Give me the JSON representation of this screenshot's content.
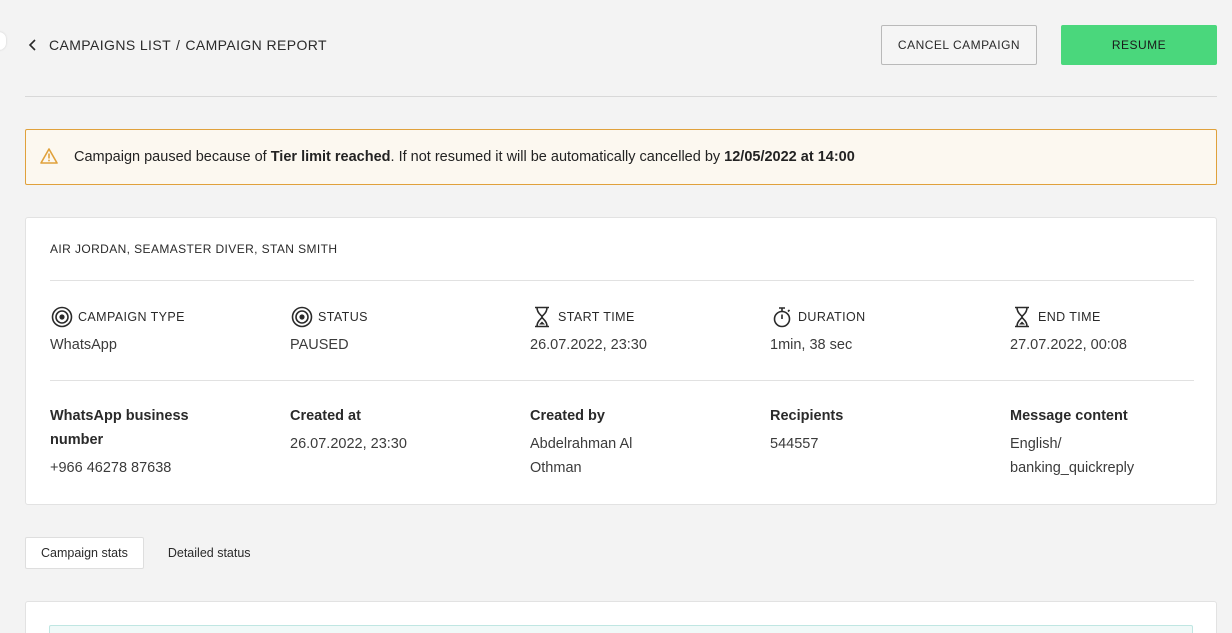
{
  "header": {
    "breadcrumb_list": "CAMPAIGNS LIST",
    "breadcrumb_sep": "/",
    "breadcrumb_current": "CAMPAIGN REPORT",
    "cancel_label": "CANCEL CAMPAIGN",
    "resume_label": "RESUME"
  },
  "alert": {
    "prefix": "Campaign paused because of ",
    "reason": "Tier limit reached",
    "middle": ". If not resumed it will be automatically cancelled by ",
    "deadline": "12/05/2022 at 14:00",
    "icon": "warning-icon"
  },
  "campaign": {
    "title": "AIR JORDAN, SEAMASTER DIVER, STAN SMITH",
    "meta": [
      {
        "icon": "target-icon",
        "label": "CAMPAIGN TYPE",
        "value": "WhatsApp"
      },
      {
        "icon": "target-icon",
        "label": "STATUS",
        "value": "PAUSED"
      },
      {
        "icon": "hourglass-icon",
        "label": "START TIME",
        "value": "26.07.2022, 23:30"
      },
      {
        "icon": "stopwatch-icon",
        "label": "DURATION",
        "value": "1min, 38 sec"
      },
      {
        "icon": "hourglass-icon",
        "label": "END TIME",
        "value": "27.07.2022, 00:08"
      }
    ],
    "info": [
      {
        "label_1": "WhatsApp business",
        "label_2": "number",
        "value_1": "+966 46278 87638",
        "value_2": ""
      },
      {
        "label_1": "Created at",
        "label_2": "",
        "value_1": "26.07.2022, 23:30",
        "value_2": ""
      },
      {
        "label_1": "Created by",
        "label_2": "",
        "value_1": "Abdelrahman Al",
        "value_2": "Othman"
      },
      {
        "label_1": "Recipients",
        "label_2": "",
        "value_1": "544557",
        "value_2": ""
      },
      {
        "label_1": "Message content",
        "label_2": "",
        "value_1": "English/",
        "value_2": "banking_quickreply"
      }
    ]
  },
  "tabs": [
    {
      "label": "Campaign stats",
      "active": true
    },
    {
      "label": "Detailed status",
      "active": false
    }
  ],
  "colors": {
    "accent_green": "#4ad77c",
    "alert_border": "#e0a13b",
    "alert_bg": "#fcf8f0",
    "background": "#f3f3f3"
  }
}
